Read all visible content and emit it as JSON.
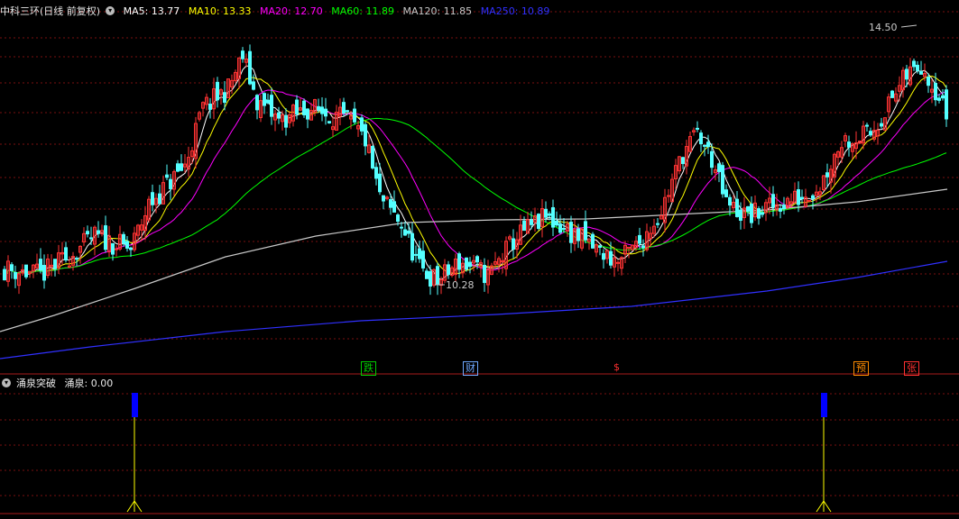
{
  "header": {
    "stock_title": "中科三环(日线 前复权)",
    "ma_labels": [
      {
        "text": "MA5: 13.77",
        "color": "#ffffff"
      },
      {
        "text": "MA10: 13.33",
        "color": "#ffff00"
      },
      {
        "text": "MA20: 12.70",
        "color": "#ff00ff"
      },
      {
        "text": "MA60: 11.89",
        "color": "#00ff00"
      },
      {
        "text": "MA120: 11.85",
        "color": "#c8c8c8"
      },
      {
        "text": "MA250: 10.89",
        "color": "#3030ff"
      }
    ]
  },
  "indicator": {
    "title": "涌泉突破",
    "value_label": "涌泉: 0.00"
  },
  "events": [
    {
      "label": "跌",
      "color": "#00cc00",
      "border": "#00cc00"
    },
    {
      "label": "财",
      "color": "#6fa8ff",
      "border": "#6fa8ff"
    },
    {
      "label": "$",
      "color": "#ff3030",
      "border": ""
    },
    {
      "label": "预",
      "color": "#ff8c00",
      "border": "#ff8c00"
    },
    {
      "label": "张",
      "color": "#ff3030",
      "border": "#ff3030"
    }
  ],
  "colors": {
    "up": "#ff3333",
    "down": "#54ffff",
    "grid": "#7a1010",
    "signal_bar": "#0000ff",
    "signal_line": "#ffff00"
  },
  "chart_data": {
    "type": "candlestick",
    "price_range": [
      9.6,
      14.9
    ],
    "high_marker": "14.50",
    "low_marker": "10.28",
    "signal_bar_indices": [
      36,
      227
    ]
  }
}
